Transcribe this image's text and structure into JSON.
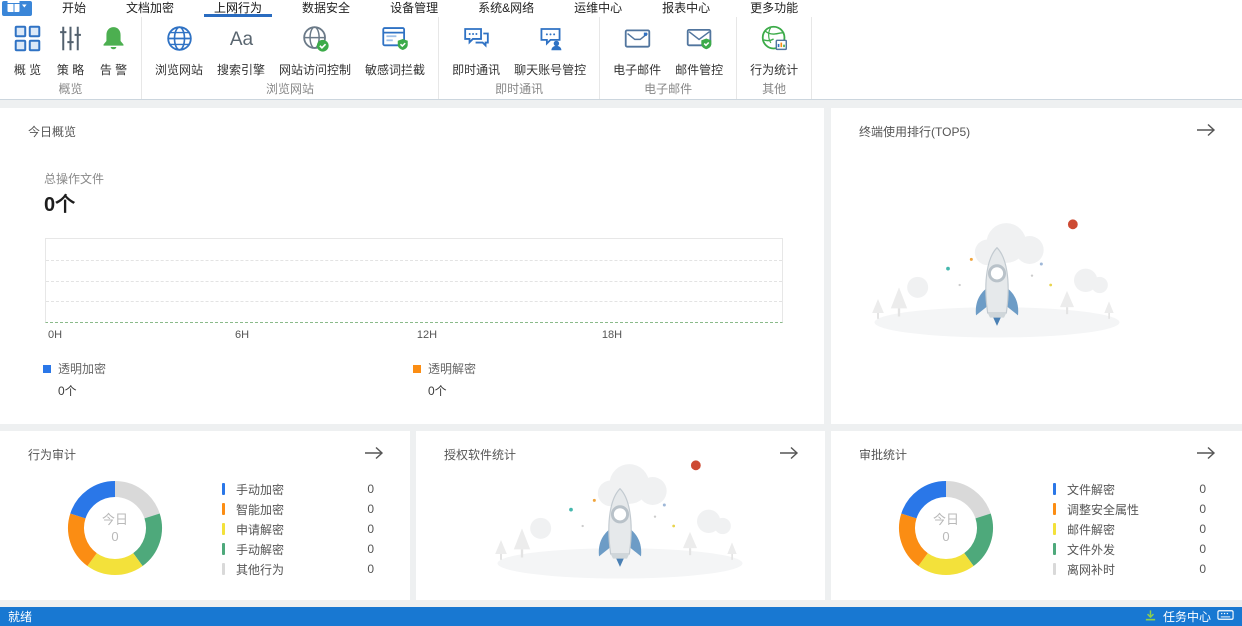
{
  "menubar": {
    "tabs": [
      {
        "label": "开始",
        "selected": false
      },
      {
        "label": "文档加密",
        "selected": false
      },
      {
        "label": "上网行为",
        "selected": true
      },
      {
        "label": "数据安全",
        "selected": false
      },
      {
        "label": "设备管理",
        "selected": false
      },
      {
        "label": "系统&网络",
        "selected": false
      },
      {
        "label": "运维中心",
        "selected": false
      },
      {
        "label": "报表中心",
        "selected": false
      },
      {
        "label": "更多功能",
        "selected": false
      }
    ]
  },
  "ribbon": {
    "groups": [
      {
        "label": "概览",
        "buttons": [
          {
            "label": "概 览",
            "icon": "grid"
          },
          {
            "label": "策 略",
            "icon": "sliders"
          },
          {
            "label": "告 警",
            "icon": "bell"
          }
        ]
      },
      {
        "label": "浏览网站",
        "buttons": [
          {
            "label": "浏览网站",
            "icon": "globe"
          },
          {
            "label": "搜索引擎",
            "icon": "search-font"
          },
          {
            "label": "网站访问控制",
            "icon": "globe-check"
          },
          {
            "label": "敏感词拦截",
            "icon": "page-shield"
          }
        ]
      },
      {
        "label": "即时通讯",
        "buttons": [
          {
            "label": "即时通讯",
            "icon": "chat"
          },
          {
            "label": "聊天账号管控",
            "icon": "chat-user"
          }
        ]
      },
      {
        "label": "电子邮件",
        "buttons": [
          {
            "label": "电子邮件",
            "icon": "mail"
          },
          {
            "label": "邮件管控",
            "icon": "mail-shield"
          }
        ]
      },
      {
        "label": "其他",
        "buttons": [
          {
            "label": "行为统计",
            "icon": "globe-stats"
          }
        ]
      }
    ]
  },
  "cards": {
    "today": {
      "title": "今日概览",
      "stat_label": "总操作文件",
      "stat_value": "0个",
      "axis_ticks": [
        "0H",
        "6H",
        "12H",
        "18H"
      ],
      "legend": [
        {
          "label": "透明加密",
          "value": "0个",
          "color": "#2a77e8"
        },
        {
          "label": "透明解密",
          "value": "0个",
          "color": "#fb8d13"
        }
      ]
    },
    "terminal_rank": {
      "title": "终端使用排行(TOP5)"
    },
    "behavior_audit": {
      "title": "行为审计",
      "center_label": "今日",
      "center_value": "0",
      "items": [
        {
          "label": "手动加密",
          "value": "0",
          "color": "#2a77e8"
        },
        {
          "label": "智能加密",
          "value": "0",
          "color": "#fb8d13"
        },
        {
          "label": "申请解密",
          "value": "0",
          "color": "#f3e13a"
        },
        {
          "label": "手动解密",
          "value": "0",
          "color": "#4ea97b"
        },
        {
          "label": "其他行为",
          "value": "0",
          "color": "#d9d9d9"
        }
      ]
    },
    "software_stats": {
      "title": "授权软件统计"
    },
    "approval_stats": {
      "title": "审批统计",
      "center_label": "今日",
      "center_value": "0",
      "items": [
        {
          "label": "文件解密",
          "value": "0",
          "color": "#2a77e8"
        },
        {
          "label": "调整安全属性",
          "value": "0",
          "color": "#fb8d13"
        },
        {
          "label": "邮件解密",
          "value": "0",
          "color": "#f3e13a"
        },
        {
          "label": "文件外发",
          "value": "0",
          "color": "#4ea97b"
        },
        {
          "label": "离网补时",
          "value": "0",
          "color": "#d9d9d9"
        }
      ]
    }
  },
  "statusbar": {
    "ready": "就绪",
    "task_center": "任务中心"
  },
  "chart_data": [
    {
      "type": "line",
      "title": "今日概览",
      "x_ticks": [
        "0H",
        "6H",
        "12H",
        "18H"
      ],
      "series": [
        {
          "name": "透明加密",
          "values": [
            0,
            0,
            0,
            0
          ]
        },
        {
          "name": "透明解密",
          "values": [
            0,
            0,
            0,
            0
          ]
        }
      ],
      "grid": "dashed-horizontal",
      "legend_position": "bottom"
    },
    {
      "type": "pie",
      "title": "行为审计",
      "center_text": "今日 0",
      "categories": [
        "手动加密",
        "智能加密",
        "申请解密",
        "手动解密",
        "其他行为"
      ],
      "values": [
        0,
        0,
        0,
        0,
        0
      ],
      "colors": [
        "#2a77e8",
        "#fb8d13",
        "#f3e13a",
        "#4ea97b",
        "#d9d9d9"
      ],
      "legend_position": "right"
    },
    {
      "type": "pie",
      "title": "审批统计",
      "center_text": "今日 0",
      "categories": [
        "文件解密",
        "调整安全属性",
        "邮件解密",
        "文件外发",
        "离网补时"
      ],
      "values": [
        0,
        0,
        0,
        0,
        0
      ],
      "colors": [
        "#2a77e8",
        "#fb8d13",
        "#f3e13a",
        "#4ea97b",
        "#d9d9d9"
      ],
      "legend_position": "right"
    }
  ]
}
